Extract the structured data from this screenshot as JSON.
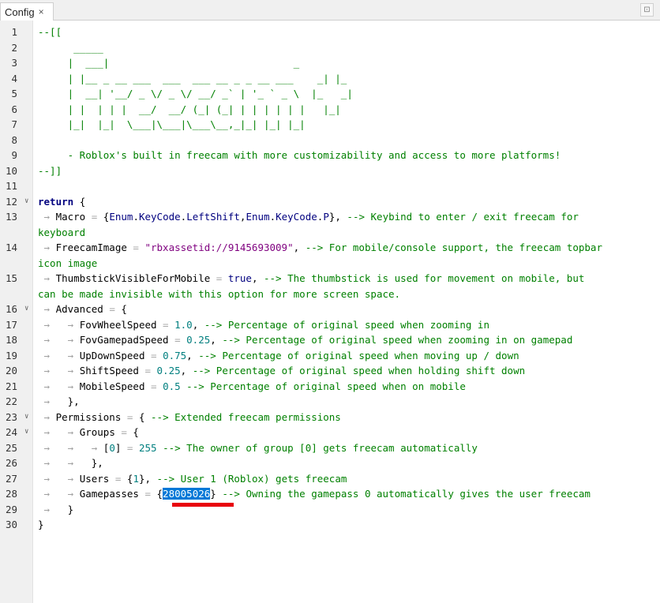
{
  "tab": {
    "label": "Config",
    "close": "×"
  },
  "lines": [
    {
      "n": "1",
      "fold": ""
    },
    {
      "n": "2",
      "fold": ""
    },
    {
      "n": "3",
      "fold": ""
    },
    {
      "n": "4",
      "fold": ""
    },
    {
      "n": "5",
      "fold": ""
    },
    {
      "n": "6",
      "fold": ""
    },
    {
      "n": "7",
      "fold": ""
    },
    {
      "n": "8",
      "fold": ""
    },
    {
      "n": "9",
      "fold": ""
    },
    {
      "n": "10",
      "fold": ""
    },
    {
      "n": "11",
      "fold": ""
    },
    {
      "n": "12",
      "fold": "∨"
    },
    {
      "n": "13",
      "fold": ""
    },
    {
      "n": "14",
      "fold": ""
    },
    {
      "n": "15",
      "fold": ""
    },
    {
      "n": "16",
      "fold": "∨"
    },
    {
      "n": "17",
      "fold": ""
    },
    {
      "n": "18",
      "fold": ""
    },
    {
      "n": "19",
      "fold": ""
    },
    {
      "n": "20",
      "fold": ""
    },
    {
      "n": "21",
      "fold": ""
    },
    {
      "n": "22",
      "fold": ""
    },
    {
      "n": "23",
      "fold": "∨"
    },
    {
      "n": "24",
      "fold": "∨"
    },
    {
      "n": "25",
      "fold": ""
    },
    {
      "n": "26",
      "fold": ""
    },
    {
      "n": "27",
      "fold": ""
    },
    {
      "n": "28",
      "fold": ""
    },
    {
      "n": "29",
      "fold": ""
    },
    {
      "n": "30",
      "fold": ""
    }
  ],
  "code": {
    "l1": "--[[",
    "l2": "      _____",
    "l3": "     |  ___|                               _",
    "l4": "     | |__ _ __ ___  ___  ___ __ _ _ __ ___    _| |_",
    "l5": "     |  __| '__/ _ \\/ _ \\/ __/ _` | '_ ` _ \\  |_   _|",
    "l6": "     | |  | | |  __/  __/ (_| (_| | | | | | |   |_|",
    "l7": "     |_|  |_|  \\___|\\___|\\___\\__,_|_| |_| |_|",
    "l9": "     - Roblox's built in freecam with more customizability and access to more platforms!",
    "l10": "--]]",
    "ret": "return",
    "macro_key": "Macro",
    "enum1": "Enum",
    "keycode1": "KeyCode",
    "leftshift": "LeftShift",
    "enum2": "Enum",
    "keycode2": "KeyCode",
    "p": "P",
    "macro_comment": "--> Keybind to enter / exit freecam for",
    "macro_comment_wrap": "keyboard",
    "img_key": "FreecamImage",
    "img_val": "\"rbxassetid://9145693009\"",
    "img_comment": "--> For mobile/console support, the freecam topbar",
    "img_comment_wrap": "icon image",
    "thumb_key": "ThumbstickVisibleForMobile",
    "thumb_val": "true",
    "thumb_comment": "--> The thumbstick is used for movement on mobile, but",
    "thumb_comment_wrap": "can be made invisible with this option for more screen space.",
    "adv_key": "Advanced",
    "fov_key": "FovWheelSpeed",
    "fov_val": "1.0",
    "fov_comment": "--> Percentage of original speed when zooming in",
    "fovg_key": "FovGamepadSpeed",
    "fovg_val": "0.25",
    "fovg_comment": "--> Percentage of original speed when zooming in on gamepad",
    "ud_key": "UpDownSpeed",
    "ud_val": "0.75",
    "ud_comment": "--> Percentage of original speed when moving up / down",
    "sh_key": "ShiftSpeed",
    "sh_val": "0.25",
    "sh_comment": "--> Percentage of original speed when holding shift down",
    "mob_key": "MobileSpeed",
    "mob_val": "0.5",
    "mob_comment": "--> Percentage of original speed when on mobile",
    "perm_key": "Permissions",
    "perm_comment": "--> Extended freecam permissions",
    "groups_key": "Groups",
    "g0": "0",
    "g0_val": "255",
    "g0_comment": "--> The owner of group [0] gets freecam automatically",
    "users_key": "Users",
    "users_val": "1",
    "users_comment": "--> User 1 (Roblox) gets freecam",
    "gp_key": "Gamepasses",
    "gp_val": "28005026",
    "gp_comment": "--> Owning the gamepass 0 automatically gives the user freecam"
  }
}
